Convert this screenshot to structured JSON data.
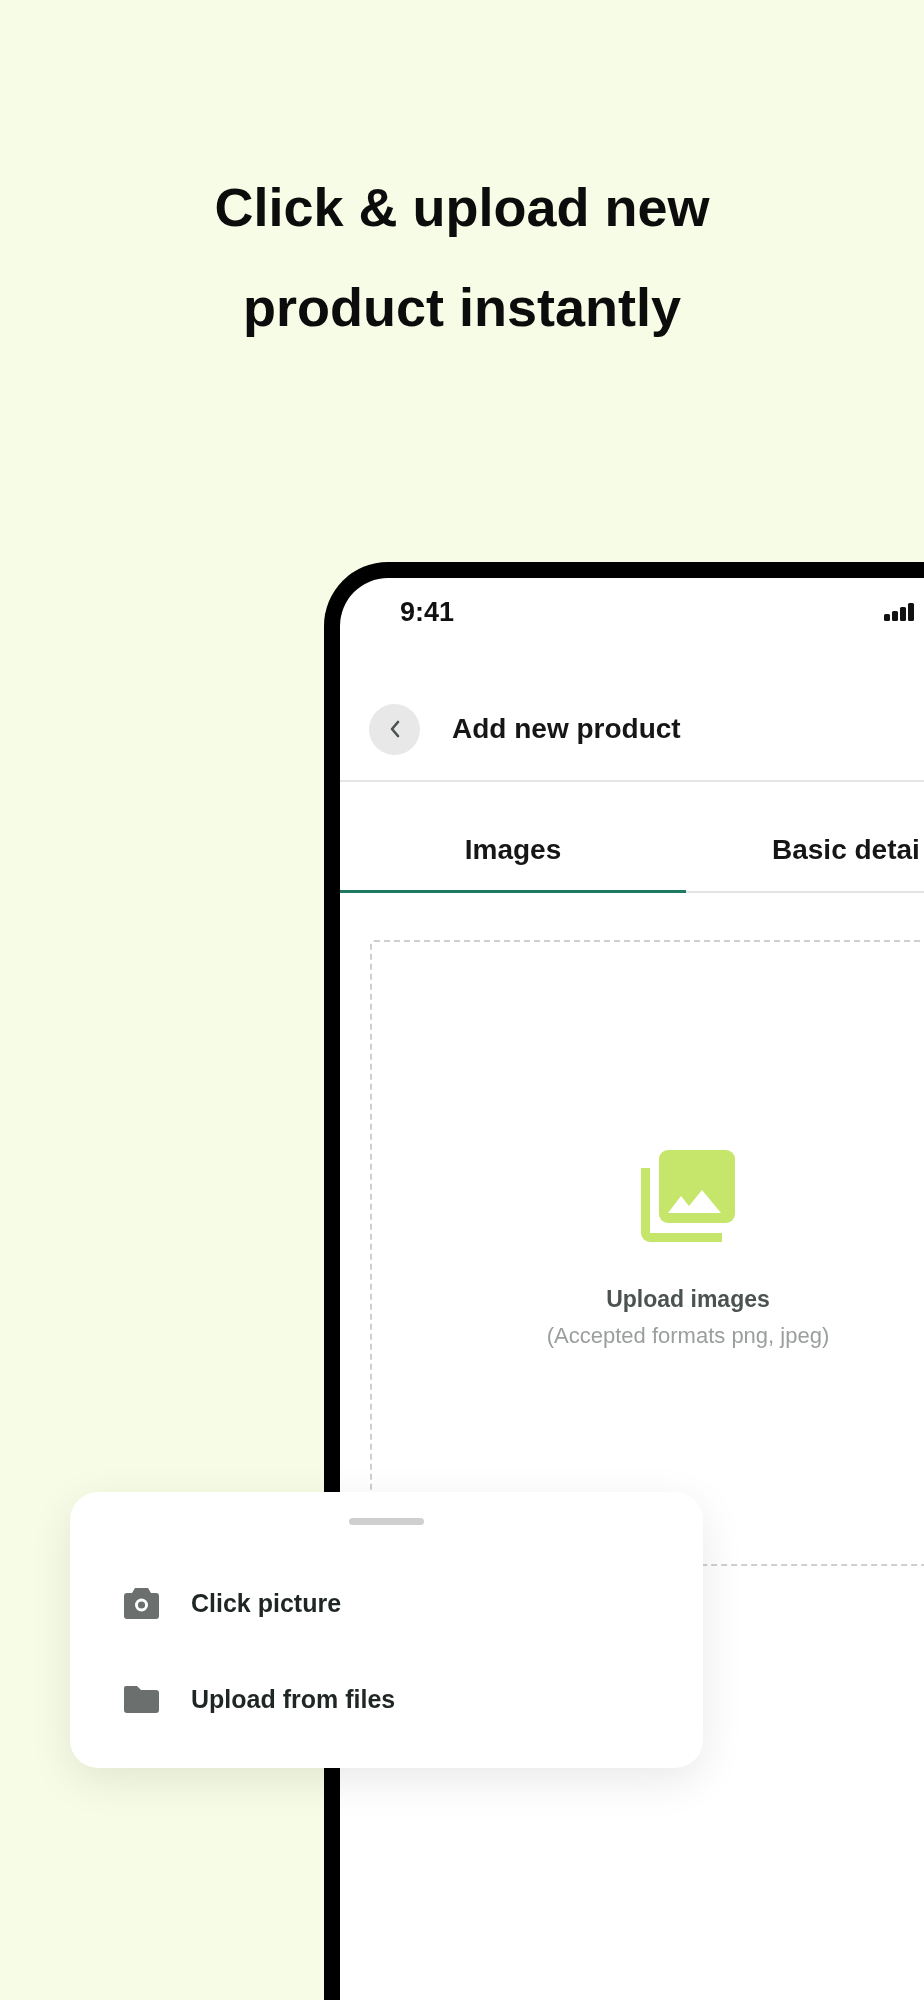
{
  "headline": "Click & upload new product instantly",
  "status_bar": {
    "time": "9:41"
  },
  "header": {
    "title": "Add new product"
  },
  "tabs": [
    {
      "label": "Images",
      "selected": true
    },
    {
      "label": "Basic detai",
      "selected": false
    }
  ],
  "upload": {
    "title": "Upload images",
    "hint": "(Accepted formats png, jpeg)"
  },
  "sheet": {
    "options": [
      {
        "kind": "camera",
        "label": "Click picture"
      },
      {
        "kind": "folder",
        "label": "Upload from files"
      }
    ]
  }
}
